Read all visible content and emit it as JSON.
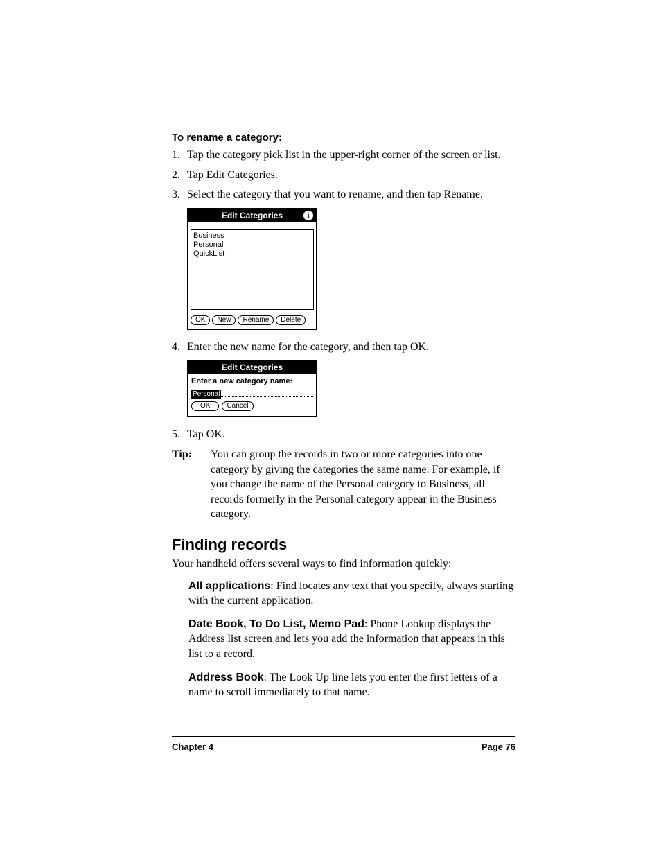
{
  "heading_rename": "To rename a category:",
  "steps": {
    "s1_num": "1.",
    "s1_txt": "Tap the category pick list in the upper-right corner of the screen or list.",
    "s2_num": "2.",
    "s2_txt": "Tap Edit Categories.",
    "s3_num": "3.",
    "s3_txt": "Select the category that you want to rename, and then tap Rename.",
    "s4_num": "4.",
    "s4_txt": "Enter the new name for the category, and then tap OK.",
    "s5_num": "5.",
    "s5_txt": "Tap OK."
  },
  "fig1": {
    "title": "Edit Categories",
    "info_glyph": "i",
    "items": {
      "i0": "Business",
      "i1": "Personal",
      "i2": "QuickList"
    },
    "buttons": {
      "ok": "OK",
      "new": "New",
      "rename": "Rename",
      "delete": "Delete"
    }
  },
  "fig2": {
    "title": "Edit Categories",
    "prompt": "Enter a new category name:",
    "input_value": "Personal",
    "buttons": {
      "ok": "OK",
      "cancel": "Cancel"
    }
  },
  "tip": {
    "label": "Tip:",
    "text": "You can group the records in two or more categories into one category by giving the categories the same name. For example, if you change the name of the Personal category to Business, all records formerly in the Personal category appear in the Business category."
  },
  "section_heading": "Finding records",
  "intro_para": "Your handheld offers several ways to find information quickly:",
  "bullets": {
    "b1_lead": "All applications",
    "b1_rest": ": Find locates any text that you specify, always starting with the current application.",
    "b2_lead": "Date Book, To Do List, Memo Pad",
    "b2_rest": ": Phone Lookup displays the Address list screen and lets you add the information that appears in this list to a record.",
    "b3_lead": "Address Book",
    "b3_rest": ": The Look Up line lets you enter the first letters of a name to scroll immediately to that name."
  },
  "footer": {
    "left": "Chapter 4",
    "right": "Page 76"
  }
}
